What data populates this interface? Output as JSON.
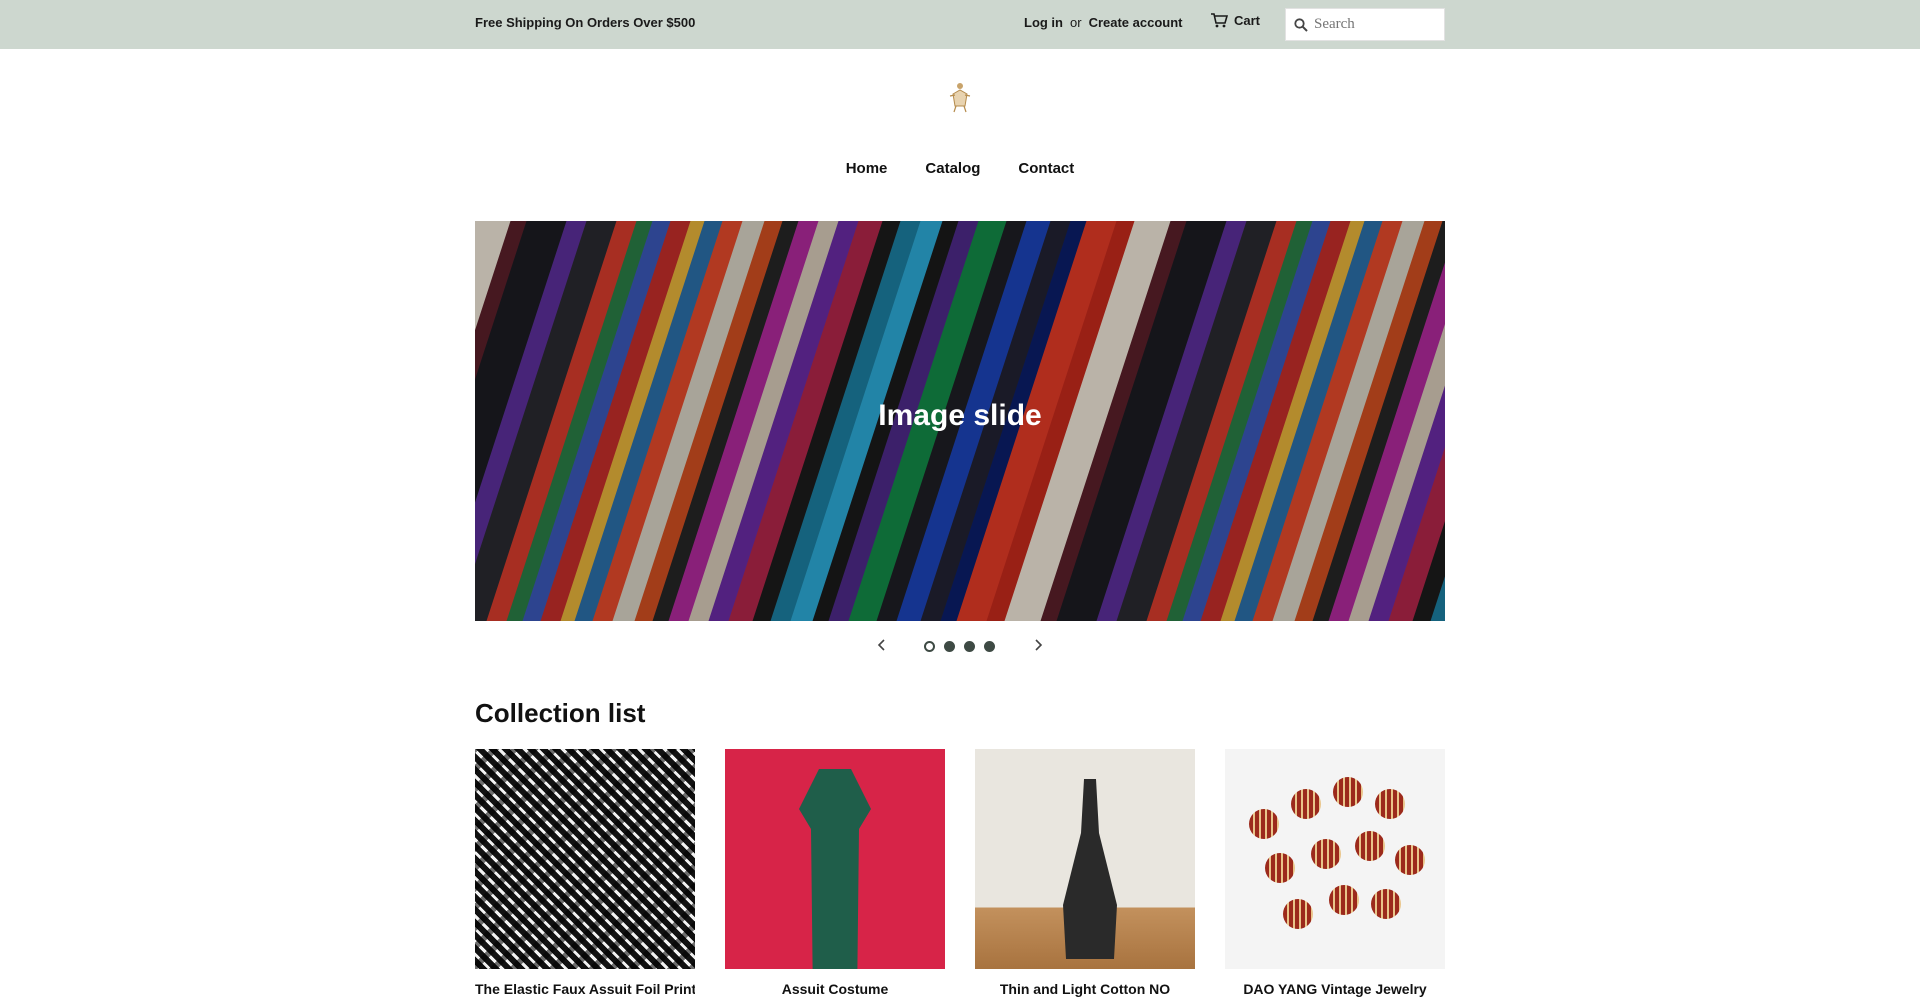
{
  "announcement": {
    "text": "Free Shipping On Orders Over $500"
  },
  "account": {
    "login": "Log in",
    "or": "or",
    "create": "Create account"
  },
  "cart": {
    "label": "Cart"
  },
  "search": {
    "placeholder": "Search"
  },
  "nav": {
    "items": [
      "Home",
      "Catalog",
      "Contact"
    ]
  },
  "slideshow": {
    "title": "Image slide",
    "slide_count": 4,
    "active_slide": 1
  },
  "collection_section": {
    "title": "Collection list"
  },
  "collections": [
    {
      "title": "The Elastic Faux Assuit Foil Print"
    },
    {
      "title": "Assuit Costume"
    },
    {
      "title": "Thin and Light Cotton NO"
    },
    {
      "title": "DAO YANG Vintage Jewelry"
    }
  ]
}
